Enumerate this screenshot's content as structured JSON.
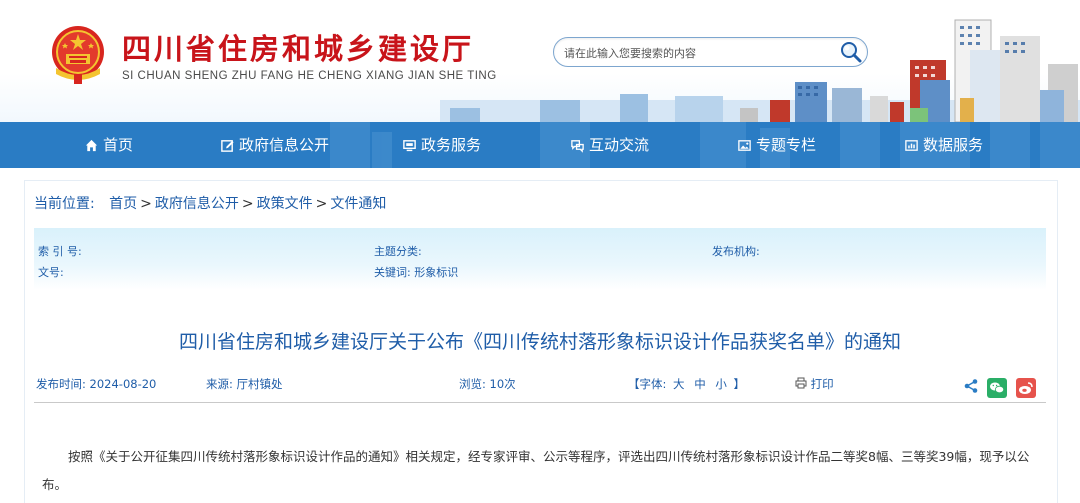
{
  "header": {
    "site_title": "四川省住房和城乡建设厅",
    "site_pinyin": "SI CHUAN SHENG ZHU FANG HE CHENG XIANG JIAN SHE TING",
    "search_placeholder": "请在此输入您要搜索的内容",
    "accent_color": "#c8141a"
  },
  "nav": {
    "background_color": "#2a7cc4",
    "items": [
      {
        "label": "首页",
        "icon": "home-icon"
      },
      {
        "label": "政府信息公开",
        "icon": "edit-icon"
      },
      {
        "label": "政务服务",
        "icon": "monitor-icon"
      },
      {
        "label": "互动交流",
        "icon": "chat-icon"
      },
      {
        "label": "专题专栏",
        "icon": "image-icon"
      },
      {
        "label": "数据服务",
        "icon": "data-icon"
      }
    ]
  },
  "breadcrumb": {
    "lead": "当前位置:",
    "items": [
      "首页",
      "政府信息公开",
      "政策文件",
      "文件通知"
    ],
    "separator": ">"
  },
  "meta": {
    "index_label": "索 引 号:",
    "doc_no_label": "文号:",
    "topic_label": "主题分类:",
    "keywords_label": "关键词:",
    "keywords_value": "形象标识",
    "publisher_label": "发布机构:"
  },
  "document": {
    "title": "四川省住房和城乡建设厅关于公布《四川传统村落形象标识设计作品获奖名单》的通知",
    "publish_label": "发布时间:",
    "publish_date": "2024-08-20",
    "source_label": "来源:",
    "source_value": "厅村镇处",
    "views_label": "浏览:",
    "views_value": "10次",
    "font_size_open": "【字体:",
    "font_sizes": [
      "大",
      "中",
      "小"
    ],
    "font_size_close": "】",
    "print_label": "打印",
    "body": "按照《关于公开征集四川传统村落形象标识设计作品的通知》相关规定，经专家评审、公示等程序，评选出四川传统村落形象标识设计作品二等奖8幅、三等奖39幅，现予以公布。"
  }
}
